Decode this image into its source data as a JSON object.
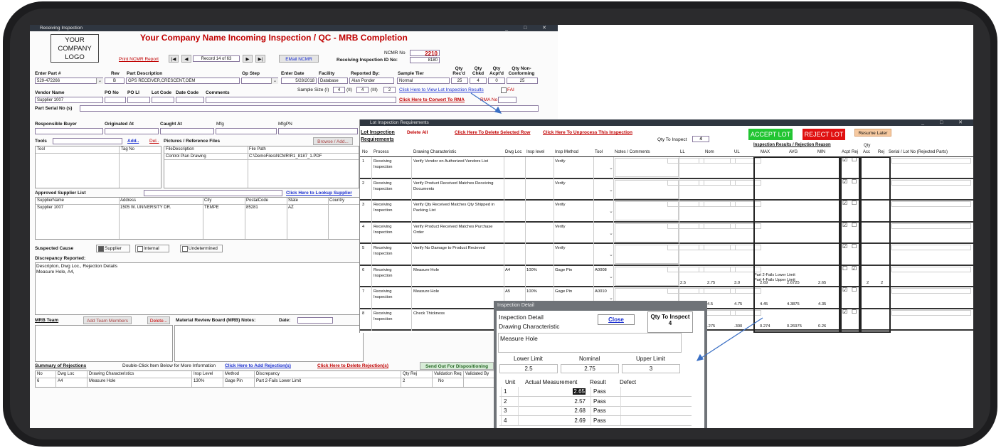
{
  "main_window": {
    "title": "Receiving Inspection",
    "logo_text": [
      "YOUR",
      "COMPANY",
      "LOGO"
    ],
    "heading": "Your Company Name Incoming Inspection / QC - MRB Completion",
    "print_link": "Print NCMR Report",
    "record_label": "Record 14 of 63",
    "email_button": "EMail NCMR",
    "ncmr_label": "NCMR No",
    "ncmr_value": "2210",
    "inspection_id_label": "Receiving Inspection ID No:",
    "inspection_id_value": "8180",
    "headers": {
      "part": "Enter Part #",
      "rev": "Rev",
      "desc": "Part Description",
      "op": "Op Step",
      "date": "Enter Date",
      "facility": "Facility",
      "reported": "Reported By:",
      "tier": "Sample Tier",
      "qty_recd": "Qty Rec'd",
      "qty_chkd": "Qty Chkd",
      "qty_acpt": "Qty Acpt'd",
      "qty_non": "Qty Non-Conforming"
    },
    "values": {
      "part": "529-472266",
      "rev": "B",
      "desc": "GPS RECEIVER,CRESCENT,OEM",
      "date": "5/28/2018",
      "facility": "Database",
      "reported": "Alan Ponder",
      "tier": "Normal",
      "qty_recd": "25",
      "qty_chkd": "4",
      "qty_acpt": "0",
      "qty_non": "25"
    },
    "vendor_headers": {
      "vendor": "Vendor Name",
      "po": "PO No",
      "poli": "PO LI",
      "lot": "Lot Code",
      "datecode": "Date Code",
      "comments": "Comments"
    },
    "vendor_value": "Supplier 1007",
    "sample_size_label": "Sample Size (I)",
    "sample_i": "4",
    "sample_ii_label": "(II)",
    "sample_ii": "4",
    "sample_iii_label": "(III)",
    "sample_iii": "2",
    "view_lot_link": "Click Here to View Lot Inspection Results",
    "fai_label": "FAI",
    "rma_link": "Click Here to Convert To RMA",
    "rma_label": "RMA No",
    "serial_label": "Part Serial No (s)",
    "buyer_label": "Responsible Buyer",
    "originated_label": "Originated At",
    "caught_label": "Caught At",
    "mfg_label": "Mfg",
    "mfgpn_label": "MfgPN",
    "tools_label": "Tools",
    "add_link": "Add..",
    "del_link": "Del..",
    "tools_cols": [
      "Tool",
      "Tag No"
    ],
    "pictures_label": "Pictures / Reference Files",
    "browse_button": "Browse / Add...",
    "files_cols": [
      "FileDescription",
      "File Path"
    ],
    "files_row": [
      "Control Plan Drawing",
      "C:\\DemoFiles\\NCMR\\R1_8187_1.PDF"
    ],
    "asl_label": "Approved Supplier List",
    "asl_link": "Click Here to Lookup Supplier",
    "asl_cols": [
      "SupplierName",
      "Address",
      "City",
      "PostalCode",
      "State",
      "Country"
    ],
    "asl_row": [
      "Supplier 1007",
      "1505 W. UNIVERSITY DR.",
      "TEMPE",
      "85281",
      "AZ",
      ""
    ],
    "cause_label": "Suspected Cause",
    "cause_supplier": "Supplier",
    "cause_internal": "Internal",
    "cause_undetermined": "Undetermined",
    "discrepancy_label": "Discrepancy Reported:",
    "discrepancy_text_1": "Descripton, Dwg Loc., Rejection Details",
    "discrepancy_text_2": "Measure Hole, A4,",
    "mrb_team_label": "MRB Team",
    "add_team_button": "Add Team Members",
    "delete_button": "Delete...",
    "mrb_notes_label": "Material Review Board (MRB) Notes:",
    "date_label": "Date:",
    "summary_label": "Summary of Rejections",
    "summary_hint": "Double-Click Item Below for More Information",
    "add_rejection_link": "Click Here to Add Rejection(s)",
    "delete_rejection_link": "Click Here to Delete Rejection(s)",
    "send_out_button": "Send Out For Dispositioning",
    "summary_cols": [
      "No",
      "Dwg Loc",
      "Drawing Characteristics",
      "Insp Level",
      "Method",
      "Discrepancy",
      "Qty Rej",
      "Validation Req",
      "Validated By"
    ],
    "summary_row": [
      "6",
      "A4",
      "Measure Hole",
      "130%",
      "Gage Pin",
      "Part 2-Fails Lower Limit",
      "2",
      "No",
      ""
    ]
  },
  "lot_window": {
    "title": "Lot Inspection Requirements",
    "heading": "Lot Inspection Requirements",
    "delete_all": "Delete All",
    "delete_selected": "Click Here To Delete Selected Row",
    "unprocess": "Click Here To Unprocess This Inspection",
    "qty_to_inspect_label": "Qty To Inspect",
    "qty_to_inspect": "4",
    "accept_button": "ACCEPT LOT",
    "reject_button": "REJECT LOT",
    "resume_button": "Resume Later",
    "results_header": "Inspection Results / Rejection Reason",
    "qty_header": "Qty",
    "cols": [
      "No",
      "Process",
      "Drawing Characteristic",
      "Dwg Loc",
      "Insp level",
      "Insp Method",
      "Tool",
      "Notes / Comments",
      "LL",
      "Nom",
      "UL",
      "MAX",
      "AVG",
      "MIN",
      "Acpt",
      "Rej",
      "Acc",
      "Rej",
      "Serial / Lot No (Rejected Parts)"
    ],
    "rows": [
      {
        "no": "1",
        "process": "Receiving Inspection",
        "char": "Verify Vendor on Authorized Vendors List",
        "loc": "",
        "level": "",
        "method": "Verify",
        "tool": "",
        "ll": "",
        "nom": "",
        "ul": "",
        "max": "",
        "avg": "",
        "min": "",
        "acpt": "☑",
        "rej": "☐",
        "acc": "",
        "rejq": "",
        "note1": "",
        "note2": ""
      },
      {
        "no": "2",
        "process": "Receiving Inspection",
        "char": "Verify Product Received Matches Receiving Documents",
        "loc": "",
        "level": "",
        "method": "Verify",
        "tool": "",
        "ll": "",
        "nom": "",
        "ul": "",
        "max": "",
        "avg": "",
        "min": "",
        "acpt": "☑",
        "rej": "☐",
        "acc": "",
        "rejq": "",
        "note1": "",
        "note2": ""
      },
      {
        "no": "3",
        "process": "Receiving Inspection",
        "char": "Verify Qty Received Matches Qty Shipped in Packing List",
        "loc": "",
        "level": "",
        "method": "Verify",
        "tool": "",
        "ll": "",
        "nom": "",
        "ul": "",
        "max": "",
        "avg": "",
        "min": "",
        "acpt": "☑",
        "rej": "☐",
        "acc": "",
        "rejq": "",
        "note1": "",
        "note2": ""
      },
      {
        "no": "4",
        "process": "Receiving Inspection",
        "char": "Verify Product Received Matches Purchase Order",
        "loc": "",
        "level": "",
        "method": "Verify",
        "tool": "",
        "ll": "",
        "nom": "",
        "ul": "",
        "max": "",
        "avg": "",
        "min": "",
        "acpt": "☑",
        "rej": "☐",
        "acc": "",
        "rejq": "",
        "note1": "",
        "note2": ""
      },
      {
        "no": "5",
        "process": "Receiving Inspection",
        "char": "Verify No Damage to Product Recieved",
        "loc": "",
        "level": "",
        "method": "Verify",
        "tool": "",
        "ll": "",
        "nom": "",
        "ul": "",
        "max": "",
        "avg": "",
        "min": "",
        "acpt": "☑",
        "rej": "☐",
        "acc": "",
        "rejq": "",
        "note1": "",
        "note2": ""
      },
      {
        "no": "6",
        "process": "Receiving Inspection",
        "char": "Measure Hole",
        "loc": "A4",
        "level": "100%",
        "method": "Gage Pin",
        "tool": "A0008",
        "ll": "2.5",
        "nom": "2.75",
        "ul": "3.0",
        "max": "2.69",
        "avg": "2.6725",
        "min": "2.65",
        "acpt": "☐",
        "rej": "☑",
        "acc": "2",
        "rejq": "2",
        "note1": "Part 2-Fails Lower Limit",
        "note2": "Part 4-Fails Upper Limit"
      },
      {
        "no": "7",
        "process": "Receiving Inspection",
        "char": "Measure Hole",
        "loc": "A5",
        "level": "100%",
        "method": "Gage Pin",
        "tool": "A0010",
        "ll": "4.25",
        "nom": "4.5",
        "ul": "4.75",
        "max": "4.45",
        "avg": "4.3875",
        "min": "4.35",
        "acpt": "☑",
        "rej": "☐",
        "acc": "",
        "rejq": "",
        "note1": "",
        "note2": ""
      },
      {
        "no": "8",
        "process": "Receiving Inspection",
        "char": "Check Thickness",
        "loc": "",
        "level": "",
        "method": "",
        "tool": "",
        "ll": "",
        "nom": ".275",
        "ul": ".300",
        "max": "0.274",
        "avg": "0.26975",
        "min": "0.26",
        "acpt": "☑",
        "rej": "☐",
        "acc": "",
        "rejq": "",
        "note1": "",
        "note2": ""
      }
    ]
  },
  "detail_window": {
    "title": "Inspection Detail",
    "heading": "Inspection Detail",
    "char_label": "Drawing Characteristic",
    "close_button": "Close",
    "qty_label": "Qty To Inspect",
    "qty_value": "4",
    "char_value": "Measure Hole",
    "lower_label": "Lower Limit",
    "nominal_label": "Nominal",
    "upper_label": "Upper Limit",
    "lower_value": "2.5",
    "nominal_value": "2.75",
    "upper_value": "3",
    "cols": [
      "Unit",
      "Actual Measurement",
      "Result",
      "Defect"
    ],
    "rows": [
      {
        "unit": "1",
        "measure": "2.65",
        "result": "Pass",
        "defect": ""
      },
      {
        "unit": "2",
        "measure": "2.57",
        "result": "Pass",
        "defect": ""
      },
      {
        "unit": "3",
        "measure": "2.68",
        "result": "Pass",
        "defect": ""
      },
      {
        "unit": "4",
        "measure": "2.69",
        "result": "Pass",
        "defect": ""
      }
    ]
  },
  "colors": {
    "accent_red": "#c00000",
    "link_blue": "#1a2fd0",
    "accept_green": "#22c532",
    "reject_red": "#e01010",
    "resume_orange": "#f6c9a0"
  }
}
